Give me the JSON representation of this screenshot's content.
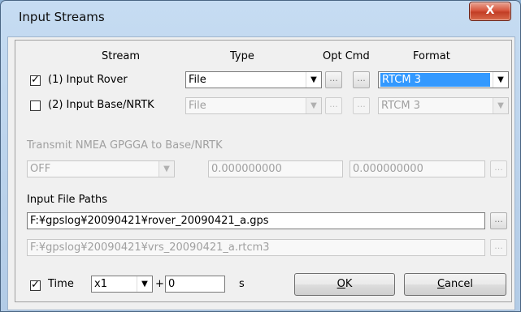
{
  "window": {
    "title": "Input Streams",
    "close_glyph": "X"
  },
  "headers": {
    "stream": "Stream",
    "type": "Type",
    "opt_cmd": "Opt Cmd",
    "format": "Format"
  },
  "streams": [
    {
      "checked": true,
      "check_glyph": "✓",
      "label": "(1) Input Rover",
      "type": "File",
      "format": "RTCM 3",
      "enabled": true
    },
    {
      "checked": false,
      "check_glyph": "",
      "label": "(2) Input Base/NRTK",
      "type": "File",
      "format": "RTCM 3",
      "enabled": false
    }
  ],
  "nmea": {
    "label": "Transmit NMEA GPGGA to Base/NRTK",
    "mode": "OFF",
    "lat": "0.000000000",
    "lon": "0.000000000"
  },
  "paths": {
    "label": "Input File Paths",
    "rover": "F:¥gpslog¥20090421¥rover_20090421_a.gps",
    "base": "F:¥gpslog¥20090421¥vrs_20090421_a.rtcm3"
  },
  "time": {
    "checked": true,
    "check_glyph": "✓",
    "label": "Time",
    "speed": "x1",
    "plus": "+",
    "offset": "0",
    "unit": "s"
  },
  "buttons": {
    "ok_u": "O",
    "ok_rest": "K",
    "cancel_u": "C",
    "cancel_rest": "ancel",
    "ellipsis": "..."
  },
  "icons": {
    "dropdown": "▼"
  }
}
